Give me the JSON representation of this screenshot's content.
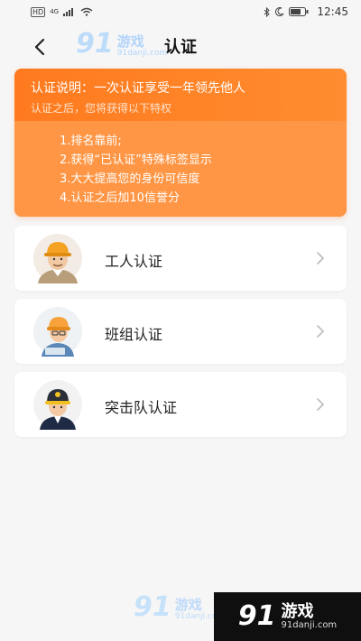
{
  "status_bar": {
    "left_indicators": "HD",
    "network": "4G",
    "time": "12:45"
  },
  "header": {
    "title": "认证",
    "back_icon": "chevron-left-icon"
  },
  "watermark": {
    "number": "91",
    "brand": "游戏",
    "site": "91danji.com"
  },
  "info_card": {
    "title": "认证说明：一次认证享受一年领先他人",
    "subtitle": "认证之后，您将获得以下特权",
    "benefits": [
      "1.排名靠前;",
      "2.获得“已认证”特殊标签显示",
      "3.大大提高您的身份可信度",
      "4.认证之后加10信誉分"
    ],
    "colors": {
      "primary": "#ff7a1e",
      "body": "#ff9645"
    }
  },
  "options": [
    {
      "label": "工人认证",
      "avatar": "worker-avatar-icon"
    },
    {
      "label": "班组认证",
      "avatar": "team-avatar-icon"
    },
    {
      "label": "突击队认证",
      "avatar": "commando-avatar-icon"
    }
  ]
}
